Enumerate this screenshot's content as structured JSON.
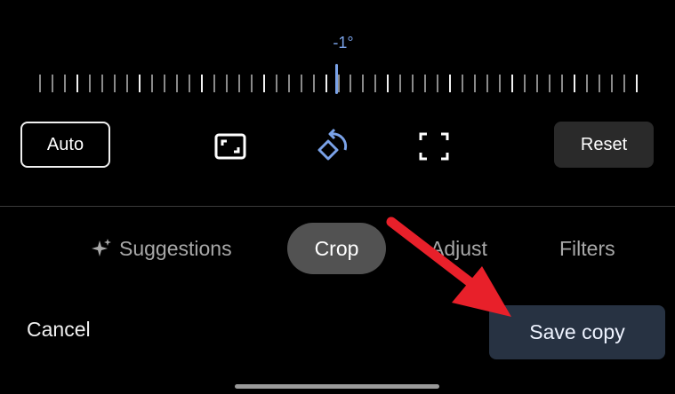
{
  "angle": {
    "value": "-1°"
  },
  "toolbar": {
    "auto_label": "Auto",
    "reset_label": "Reset",
    "icons": [
      "aspect-ratio-icon",
      "rotate-icon",
      "free-crop-icon"
    ]
  },
  "tabs": [
    {
      "label": "Suggestions",
      "active": false
    },
    {
      "label": "Crop",
      "active": true
    },
    {
      "label": "Adjust",
      "active": false
    },
    {
      "label": "Filters",
      "active": false
    }
  ],
  "footer": {
    "cancel_label": "Cancel",
    "save_label": "Save copy"
  },
  "colors": {
    "accent": "#7aa2e8",
    "save_bg": "#273242",
    "annotation_arrow": "#e8202a"
  }
}
